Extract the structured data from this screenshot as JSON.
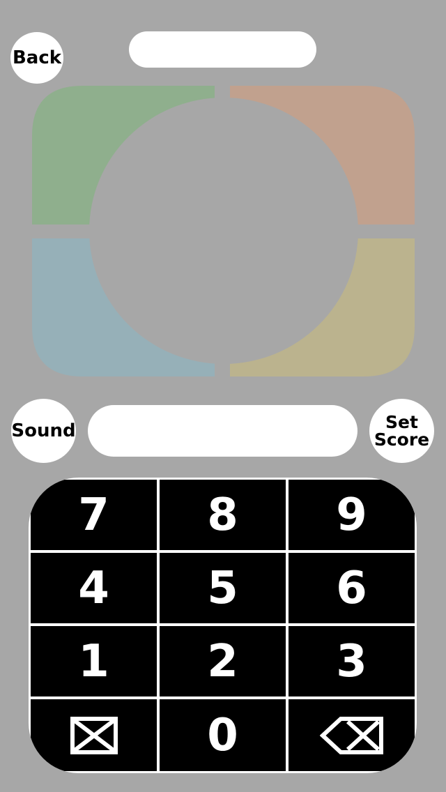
{
  "header": {
    "back_label": "Back"
  },
  "controls": {
    "sound_label": "Sound",
    "set_score_label": "Set\nScore"
  },
  "colors": {
    "background": "#a7a7a7",
    "green_pad": "#8faf8d",
    "orange_pad": "#c1a18e",
    "blue_pad": "#96b0b8",
    "yellow_pad": "#bbb38e",
    "keypad_bg": "#000000",
    "keypad_border": "#ffffff"
  },
  "keypad": {
    "keys": [
      "7",
      "8",
      "9",
      "4",
      "5",
      "6",
      "1",
      "2",
      "3",
      "",
      "0",
      ""
    ],
    "clear_icon": "clear-box-icon",
    "backspace_icon": "backspace-icon"
  }
}
